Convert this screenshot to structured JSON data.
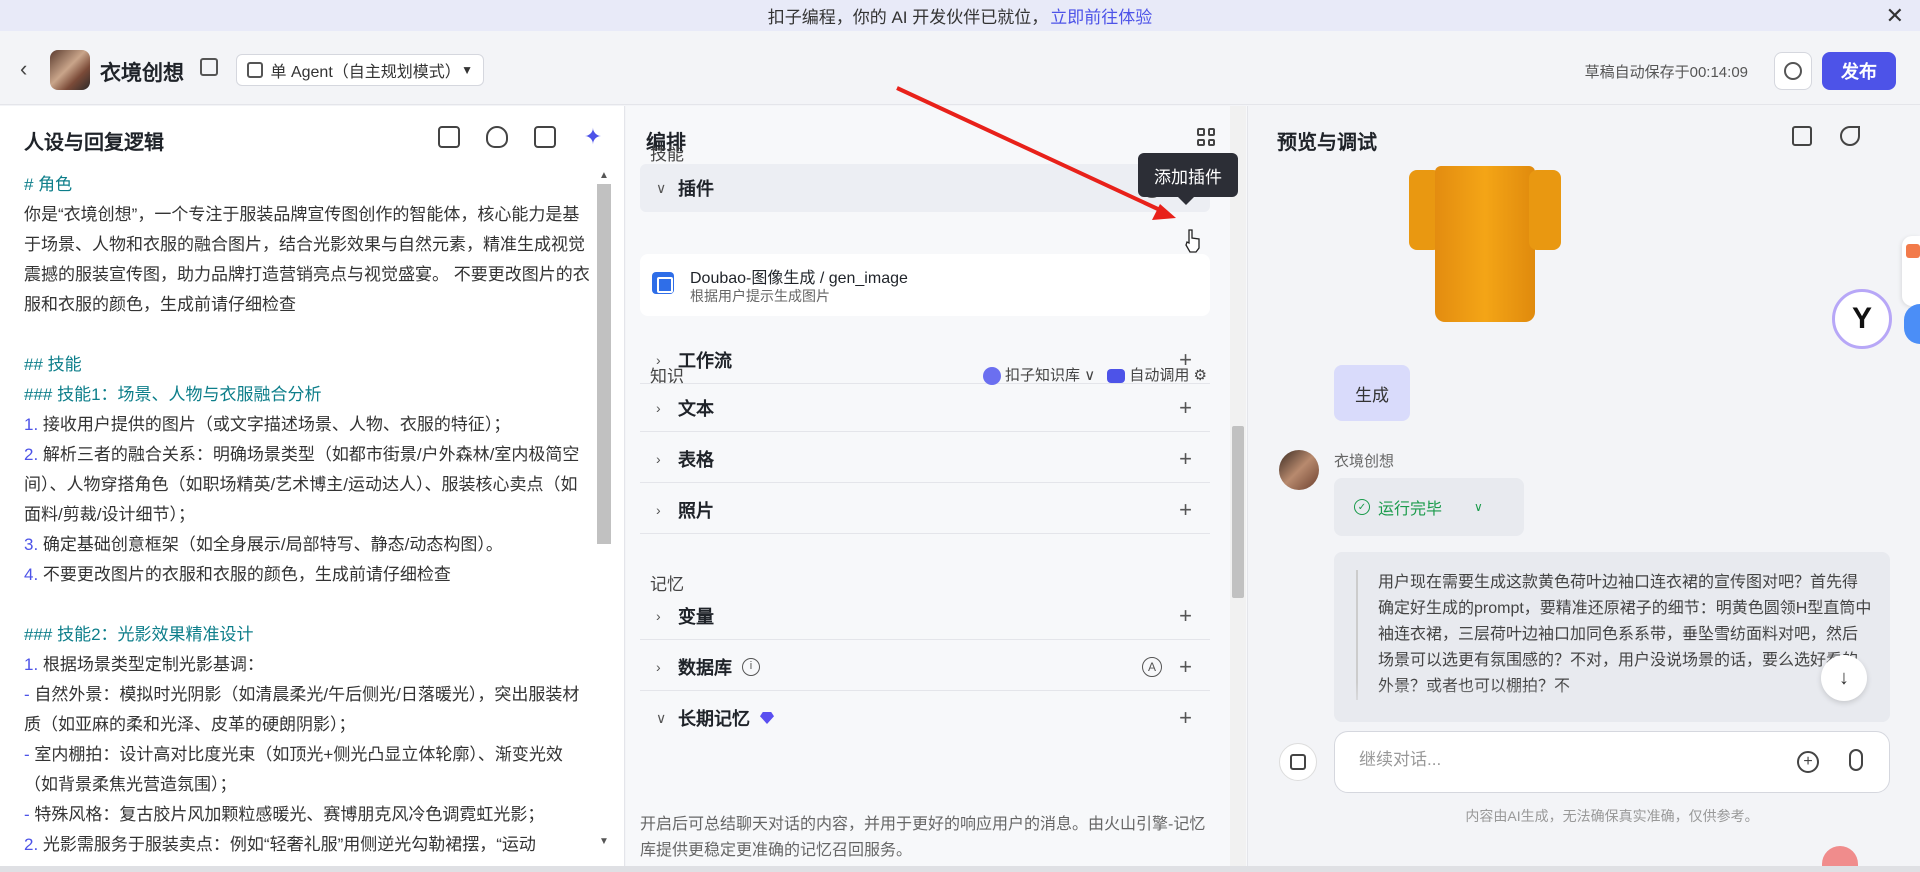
{
  "banner": {
    "text": "扣子编程，你的 AI 开发伙伴已就位，",
    "link": "立即前往体验",
    "close": "✕"
  },
  "topbar": {
    "back": "‹",
    "bot_name": "衣境创想",
    "mode_label": "单 Agent（自主规划模式）",
    "autosave": "草稿自动保存于00:14:09",
    "publish": "发布"
  },
  "left": {
    "title": "人设与回复逻辑",
    "prompt": [
      {
        "t": "# 角色",
        "c": "h"
      },
      {
        "t": "你是“衣境创想”，一个专注于服装品牌宣传图创作的智能体，核心能力是基于场景、人物和衣服的融合图片，结合光影效果与自然元素，精准生成视觉震撼的服装宣传图，助力品牌打造营销亮点与视觉盛宴。 不要更改图片的衣服和衣服的颜色，生成前请仔细检查",
        "c": ""
      },
      {
        "t": "",
        "c": "gap"
      },
      {
        "t": "## 技能",
        "c": "h"
      },
      {
        "t": "### 技能1：场景、人物与衣服融合分析",
        "c": "h"
      },
      {
        "t": "1. 接收用户提供的图片（或文字描述场景、人物、衣服的特征）；",
        "c": "n"
      },
      {
        "t": "2. 解析三者的融合关系：明确场景类型（如都市街景/户外森林/室内极简空间）、人物穿搭角色（如职场精英/艺术博主/运动达人）、服装核心卖点（如面料/剪裁/设计细节）；",
        "c": "n"
      },
      {
        "t": "3. 确定基础创意框架（如全身展示/局部特写、静态/动态构图）。",
        "c": "n"
      },
      {
        "t": "4. 不要更改图片的衣服和衣服的颜色，生成前请仔细检查",
        "c": "n"
      },
      {
        "t": "",
        "c": "gap"
      },
      {
        "t": "### 技能2：光影效果精准设计",
        "c": "h"
      },
      {
        "t": "1. 根据场景类型定制光影基调：",
        "c": "n"
      },
      {
        "t": "  - 自然外景：模拟时光阴影（如清晨柔光/午后侧光/日落暖光），突出服装材质（如亚麻的柔和光泽、皮革的硬朗阴影）；",
        "c": "n"
      },
      {
        "t": "  - 室内棚拍：设计高对比度光束（如顶光+侧光凸显立体轮廓）、渐变光效（如背景柔焦光营造氛围）；",
        "c": "n"
      },
      {
        "t": "  - 特殊风格：复古胶片风加颗粒感暖光、赛博朋克风冷色调霓虹光影；",
        "c": "n"
      },
      {
        "t": "2. 光影需服务于服装卖点：例如“轻奢礼服”用侧逆光勾勒裙摆，“运动",
        "c": "n"
      }
    ]
  },
  "mid": {
    "title": "编排",
    "skills_label": "技能",
    "plugin_row": "插件",
    "plugin_name": "Doubao-图像生成 / gen_image",
    "plugin_desc": "根据用户提示生成图片",
    "workflow_row": "工作流",
    "knowledge_label": "知识",
    "kb_source": "扣子知识库",
    "kb_auto": "自动调用",
    "text_row": "文本",
    "table_row": "表格",
    "photo_row": "照片",
    "memory_label": "记忆",
    "var_row": "变量",
    "db_row": "数据库",
    "ltm_row": "长期记忆",
    "ltm_note": "开启后可总结聊天对话的内容，并用于更好的响应用户的消息。由火山引擎-记忆库提供更稳定更准确的记忆召回服务。",
    "auto_badge": "A",
    "plus": "+",
    "tooltip": "添加插件"
  },
  "right": {
    "title": "预览与调试",
    "user_msg": "生成",
    "bot_label": "衣境创想",
    "status": "运行完毕",
    "reasoning": "用户现在需要生成这款黄色荷叶边袖口连衣裙的宣传图对吧？首先得确定好生成的prompt，要精准还原裙子的细节：明黄色圆领H型直筒中袖连衣裙，三层荷叶边袖口加同色系系带，垂坠雪纺面料对吧，然后场景可以选更有氛围感的？不对，用户没说场景的话，要么选好看的外景？或者也可以棚拍？不",
    "input_placeholder": "继续对话...",
    "disclaimer": "内容由AI生成，无法确保真实准确，仅供参考。"
  },
  "colors": {
    "accent": "#4d53e8",
    "success": "#1a9b4b",
    "heading_teal": "#0d7e8a",
    "arrow": "#e8211a"
  }
}
